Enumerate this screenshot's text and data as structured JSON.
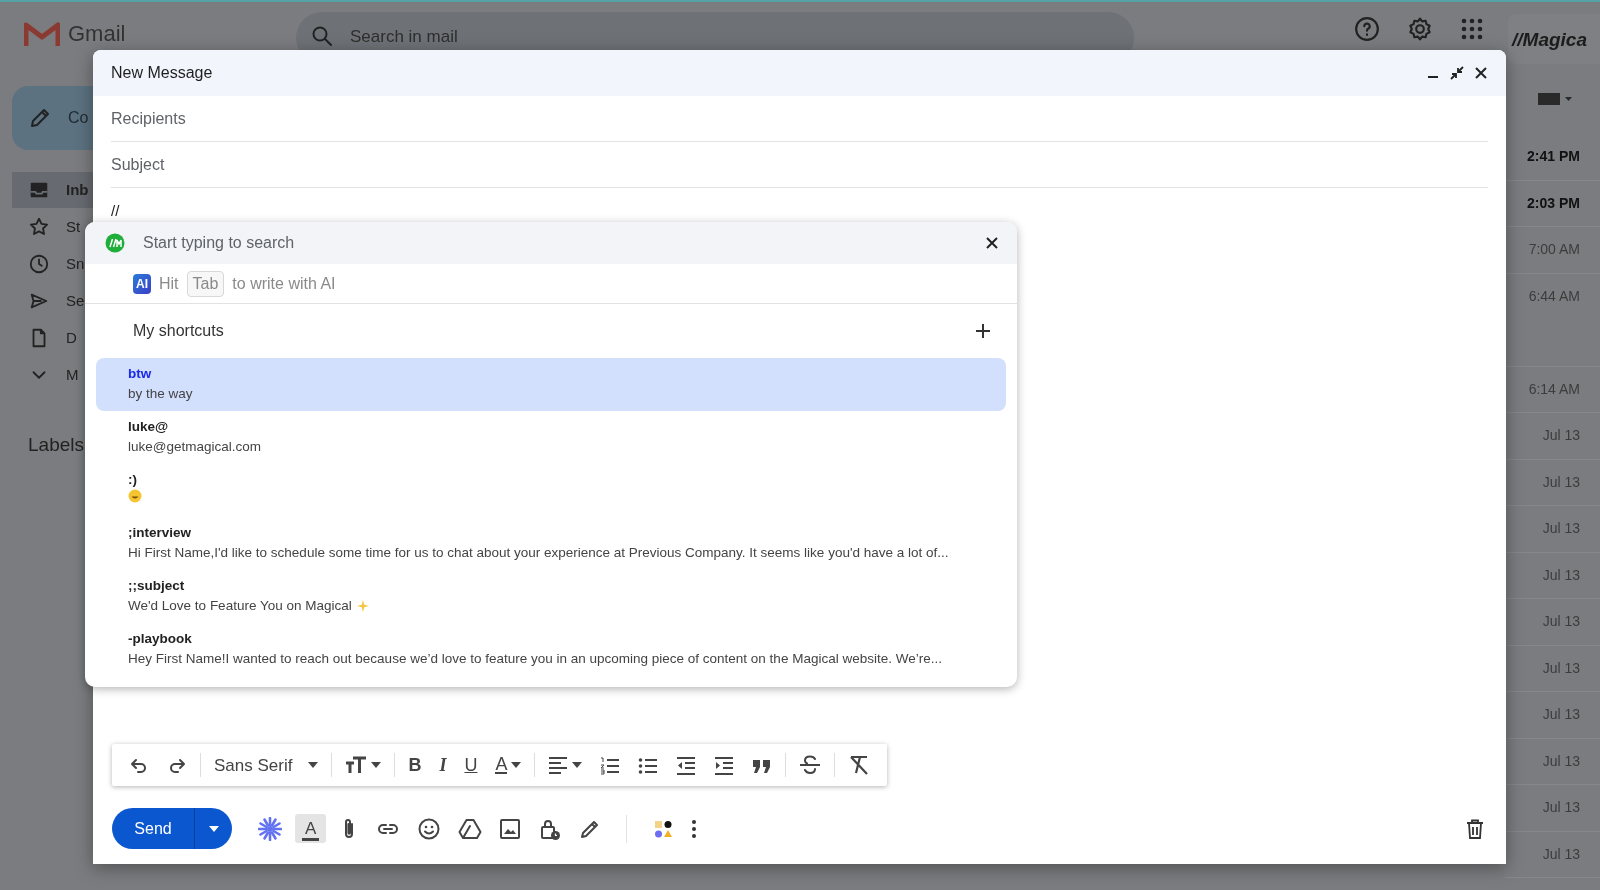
{
  "app": {
    "logo_text": "Gmail",
    "search_placeholder": "Search in mail",
    "brand": "//Magica"
  },
  "sidebar": {
    "compose": "Co",
    "items": [
      {
        "label": "Inb",
        "selected": true
      },
      {
        "label": "St",
        "selected": false
      },
      {
        "label": "Sn",
        "selected": false
      },
      {
        "label": "Se",
        "selected": false
      },
      {
        "label": "D",
        "selected": false
      },
      {
        "label": "M",
        "selected": false
      }
    ],
    "labels_heading": "Labels"
  },
  "mail_times": [
    {
      "text": "2:41 PM",
      "unread": true
    },
    {
      "text": "2:03 PM",
      "unread": true
    },
    {
      "text": "7:00 AM",
      "unread": false
    },
    {
      "text": "6:44 AM",
      "unread": false
    },
    {
      "text": "6:14 AM",
      "unread": false
    },
    {
      "text": "Jul 13",
      "unread": false
    },
    {
      "text": "Jul 13",
      "unread": false
    },
    {
      "text": "Jul 13",
      "unread": false
    },
    {
      "text": "Jul 13",
      "unread": false
    },
    {
      "text": "Jul 13",
      "unread": false
    },
    {
      "text": "Jul 13",
      "unread": false
    },
    {
      "text": "Jul 13",
      "unread": false
    },
    {
      "text": "Jul 13",
      "unread": false
    },
    {
      "text": "Jul 13",
      "unread": false
    },
    {
      "text": "Jul 13",
      "unread": false
    }
  ],
  "compose": {
    "title": "New Message",
    "recipients_placeholder": "Recipients",
    "subject_placeholder": "Subject",
    "body": "//",
    "popup": {
      "search_placeholder": "Start typing to search",
      "ai_badge": "AI",
      "ai_hint_before": "Hit",
      "ai_key": "Tab",
      "ai_hint_after": "to write with AI",
      "section": "My shortcuts",
      "shortcuts": [
        {
          "kind": "text",
          "key": "btw",
          "text": "by the way",
          "sparkle": false,
          "selected": true
        },
        {
          "kind": "text",
          "key": "luke@",
          "text": "luke@getmagical.com",
          "sparkle": false,
          "selected": false
        },
        {
          "kind": "emoji",
          "key": ":)",
          "sparkle": false,
          "selected": false
        },
        {
          "kind": "text",
          "key": ";interview",
          "text": "Hi First Name,I'd like to schedule some time for us to chat about your experience at Previous Company. It seems like you'd have a lot of...",
          "sparkle": false,
          "selected": false
        },
        {
          "kind": "text",
          "key": ";;subject",
          "text": "We'd Love to Feature You on Magical",
          "sparkle": true,
          "selected": false
        },
        {
          "kind": "text",
          "key": "-playbook",
          "text": "Hey First Name!I wanted to reach out because we’d love to feature you in an upcoming piece of content on the Magical website. We’re...",
          "sparkle": false,
          "selected": false
        }
      ]
    },
    "toolbar": {
      "font": "Sans Serif",
      "bold": "B",
      "italic": "I",
      "underline": "U",
      "text_color": "A"
    },
    "send": "Send",
    "format_toggle": "A",
    "format_on": true
  }
}
